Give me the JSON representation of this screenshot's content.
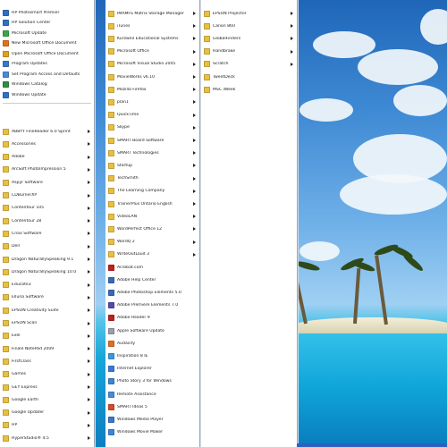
{
  "column1": {
    "pinned": [
      {
        "label": "HP Photosmart Premier",
        "color": "#2f6fc9"
      },
      {
        "label": "HP Solution Center",
        "color": "#2f6fc9"
      },
      {
        "label": "Microsoft Update",
        "color": "#3aa54a"
      },
      {
        "label": "New Microsoft Office Document",
        "color": "#e07020"
      },
      {
        "label": "Open Microsoft Office Document",
        "color": "#e0a020"
      },
      {
        "label": "Program Updates",
        "color": "#3a78c8"
      },
      {
        "label": "Set Program Access and Defaults",
        "color": "#4a8ad8"
      },
      {
        "label": "Windows Catalog",
        "color": "#2f8f3f"
      },
      {
        "label": "Windows Update",
        "color": "#2f6fc9"
      }
    ],
    "programs": [
      {
        "label": "ABBYY FineReader 6.0 Sprint",
        "color": "#e8c040",
        "submenu": true
      },
      {
        "label": "Accessories",
        "color": "#e8c040",
        "submenu": true
      },
      {
        "label": "Adobe",
        "color": "#e8c040",
        "submenu": true
      },
      {
        "label": "ArcSoft PhotoImpression 5",
        "color": "#e8c040",
        "submenu": true
      },
      {
        "label": "Aspyr Software",
        "color": "#e8c040",
        "submenu": true
      },
      {
        "label": "CDBurnerXP",
        "color": "#e8c040",
        "submenu": true
      },
      {
        "label": "Contentour 105",
        "color": "#e8c040",
        "submenu": true
      },
      {
        "label": "Contentour 28",
        "color": "#e8c040",
        "submenu": true
      },
      {
        "label": "Croix Software",
        "color": "#e8c040",
        "submenu": true
      },
      {
        "label": "Dell",
        "color": "#e8c040",
        "submenu": true
      },
      {
        "label": "Dragon NaturallySpeaking 9.1",
        "color": "#e8c040",
        "submenu": true
      },
      {
        "label": "Dragon NaturallySpeaking 10.0",
        "color": "#e8c040",
        "submenu": true
      },
      {
        "label": "Educate3",
        "color": "#e8c040",
        "submenu": true
      },
      {
        "label": "Elluna Software",
        "color": "#e8c040",
        "submenu": true
      },
      {
        "label": "EPSON Creativity Suite",
        "color": "#e8c040",
        "submenu": true
      },
      {
        "label": "EPSON Scan",
        "color": "#e8c040",
        "submenu": true
      },
      {
        "label": "Exel",
        "color": "#e8c040",
        "submenu": true
      },
      {
        "label": "Finale NotePad 2009",
        "color": "#e8c040",
        "submenu": true
      },
      {
        "label": "FirstClass",
        "color": "#e8c040",
        "submenu": true
      },
      {
        "label": "Games",
        "color": "#e8c040",
        "submenu": true
      },
      {
        "label": "GEY Express",
        "color": "#e8c040",
        "submenu": true
      },
      {
        "label": "Google Earth",
        "color": "#e8c040",
        "submenu": true
      },
      {
        "label": "Google Updater",
        "color": "#e8c040",
        "submenu": true
      },
      {
        "label": "HP",
        "color": "#e8c040",
        "submenu": true
      },
      {
        "label": "HyperStudio® 4.5",
        "color": "#e8c040",
        "submenu": true
      }
    ]
  },
  "column2": [
    {
      "label": "IMAMFS Matrix Storage Manager",
      "color": "#e8c040",
      "submenu": true
    },
    {
      "label": "iTunes",
      "color": "#e8c040",
      "submenu": true
    },
    {
      "label": "Kurzweil Educational Systems",
      "color": "#e8c040",
      "submenu": true
    },
    {
      "label": "Microsoft Office",
      "color": "#e8c040",
      "submenu": true
    },
    {
      "label": "Microsoft Visual Studio 2005",
      "color": "#e8c040",
      "submenu": true
    },
    {
      "label": "MovieWorks v6.10",
      "color": "#e8c040",
      "submenu": true
    },
    {
      "label": "Mozilla Firefox",
      "color": "#e8c040",
      "submenu": true
    },
    {
      "label": "plan1",
      "color": "#e8c040",
      "submenu": true
    },
    {
      "label": "QuickTime",
      "color": "#e8c040",
      "submenu": true
    },
    {
      "label": "Skype",
      "color": "#e8c040",
      "submenu": true
    },
    {
      "label": "SMART Board Software",
      "color": "#e8c040",
      "submenu": true
    },
    {
      "label": "SMART Technologies",
      "color": "#e8c040",
      "submenu": true
    },
    {
      "label": "Startup",
      "color": "#e8c040",
      "submenu": true
    },
    {
      "label": "TechSmith",
      "color": "#e8c040",
      "submenu": true
    },
    {
      "label": "The Learning Company",
      "color": "#e8c040",
      "submenu": true
    },
    {
      "label": "TrainerPlus Ontario English",
      "color": "#e8c040",
      "submenu": true
    },
    {
      "label": "VideoLAN",
      "color": "#e8c040",
      "submenu": true
    },
    {
      "label": "WordPerfect Office 12",
      "color": "#e8c040",
      "submenu": true
    },
    {
      "label": "WordQ 2",
      "color": "#e8c040",
      "submenu": true
    },
    {
      "label": "WriteOutLoud 3",
      "color": "#e8c040",
      "submenu": true
    },
    {
      "label": "Acrobat.com",
      "color": "#c02020",
      "submenu": false
    },
    {
      "label": "Adobe Help Center",
      "color": "#3a68b8",
      "submenu": false
    },
    {
      "label": "Adobe Photoshop Elements 5.0",
      "color": "#3a68b8",
      "submenu": false
    },
    {
      "label": "Adobe Premiere Elements 7.0",
      "color": "#5a48a8",
      "submenu": false
    },
    {
      "label": "Adobe Reader 9",
      "color": "#c02020",
      "submenu": false
    },
    {
      "label": "Apple Software Update",
      "color": "#9aa0a8",
      "submenu": false
    },
    {
      "label": "Audacity",
      "color": "#e07020",
      "submenu": false
    },
    {
      "label": "Inspiration 8 IE",
      "color": "#3a98d8",
      "submenu": false
    },
    {
      "label": "Internet Explorer",
      "color": "#3a78d8",
      "submenu": false
    },
    {
      "label": "Photo Story 3 for Windows",
      "color": "#3a88c8",
      "submenu": false
    },
    {
      "label": "Remote Assistance",
      "color": "#4a8ad8",
      "submenu": false
    },
    {
      "label": "SMART Ideas 5",
      "color": "#d84a2a",
      "submenu": false
    },
    {
      "label": "Windows Media Player",
      "color": "#3a78c8",
      "submenu": false
    },
    {
      "label": "Windows Movie Maker",
      "color": "#3a88d8",
      "submenu": false
    }
  ],
  "column3": [
    {
      "label": "EPSON Projector",
      "color": "#e8c040",
      "submenu": true
    },
    {
      "label": "Canon 860",
      "color": "#e8c040",
      "submenu": true
    },
    {
      "label": "GlobalFinders",
      "color": "#e8c040",
      "submenu": true
    },
    {
      "label": "Handbrake",
      "color": "#e8c040",
      "submenu": true
    },
    {
      "label": "Scratch",
      "color": "#e8c040",
      "submenu": true
    },
    {
      "label": "TweetDeck",
      "color": "#e8c040",
      "submenu": false
    },
    {
      "label": "MSC iWeek",
      "color": "#e8c040",
      "submenu": false
    }
  ]
}
